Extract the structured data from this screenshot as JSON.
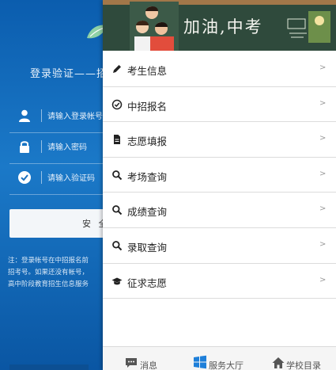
{
  "login": {
    "title": "登录验证——招",
    "username_placeholder": "请输入登录帐号",
    "password_placeholder": "请输入密码",
    "captcha_placeholder": "请输入验证码",
    "submit_label": "安 全",
    "note": "注：登录帐号在中招报名前\n招考号。如果还没有帐号，\n高中阶段教育招生信息服务"
  },
  "banner": {
    "text": "加油,中考"
  },
  "menu": {
    "items": [
      {
        "label": "考生信息",
        "icon": "pencil-icon",
        "arrow": ">"
      },
      {
        "label": "中招报名",
        "icon": "check-circle-icon",
        "arrow": ">"
      },
      {
        "label": "志愿填报",
        "icon": "document-icon",
        "arrow": ">"
      },
      {
        "label": "考场查询",
        "icon": "search-icon",
        "arrow": ">"
      },
      {
        "label": "成绩查询",
        "icon": "search-icon",
        "arrow": ">"
      },
      {
        "label": "录取查询",
        "icon": "search-icon",
        "arrow": ">"
      },
      {
        "label": "征求志愿",
        "icon": "graduation-cap-icon",
        "arrow": ">"
      }
    ]
  },
  "tabbar": {
    "items": [
      {
        "label": "消息",
        "icon": "message-icon"
      },
      {
        "label": "服务大厅",
        "icon": "windows-icon"
      },
      {
        "label": "学校目录",
        "icon": "home-icon"
      }
    ]
  },
  "colors": {
    "login_bg": "#0b5dae",
    "menu_text": "#222222",
    "hall_icon": "#1e7fd9",
    "banner_board": "#2f4a3c"
  }
}
